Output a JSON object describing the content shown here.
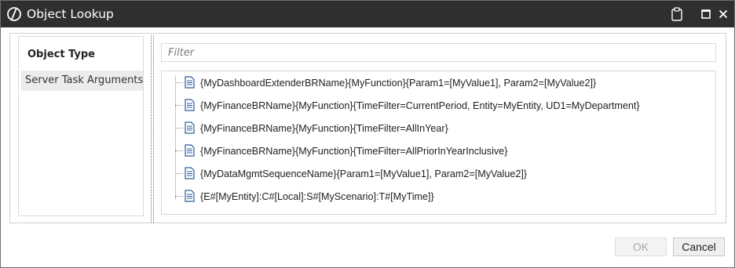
{
  "window": {
    "title": "Object Lookup",
    "icons": [
      "app-logo-icon",
      "clipboard-icon",
      "maximize-icon",
      "close-icon"
    ]
  },
  "object_type": {
    "header": "Object Type",
    "items": [
      "Server Task Arguments"
    ],
    "selected": "Server Task Arguments"
  },
  "filter": {
    "placeholder": "Filter",
    "value": ""
  },
  "tree": {
    "items": [
      "{MyDashboardExtenderBRName}{MyFunction}{Param1=[MyValue1], Param2=[MyValue2]}",
      "{MyFinanceBRName}{MyFunction}{TimeFilter=CurrentPeriod, Entity=MyEntity, UD1=MyDepartment}",
      "{MyFinanceBRName}{MyFunction}{TimeFilter=AllInYear}",
      "{MyFinanceBRName}{MyFunction}{TimeFilter=AllPriorInYearInclusive}",
      "{MyDataMgmtSequenceName}{Param1=[MyValue1], Param2=[MyValue2]}",
      "{E#[MyEntity]:C#[Local]:S#[MyScenario]:T#[MyTime]}"
    ],
    "item_icon": "document-icon"
  },
  "buttons": {
    "ok": "OK",
    "ok_enabled": false,
    "cancel": "Cancel"
  },
  "colors": {
    "titlebar": "#2f2f2f",
    "selected_item": "#ececec",
    "icon_blue": "#2b5d9c"
  }
}
